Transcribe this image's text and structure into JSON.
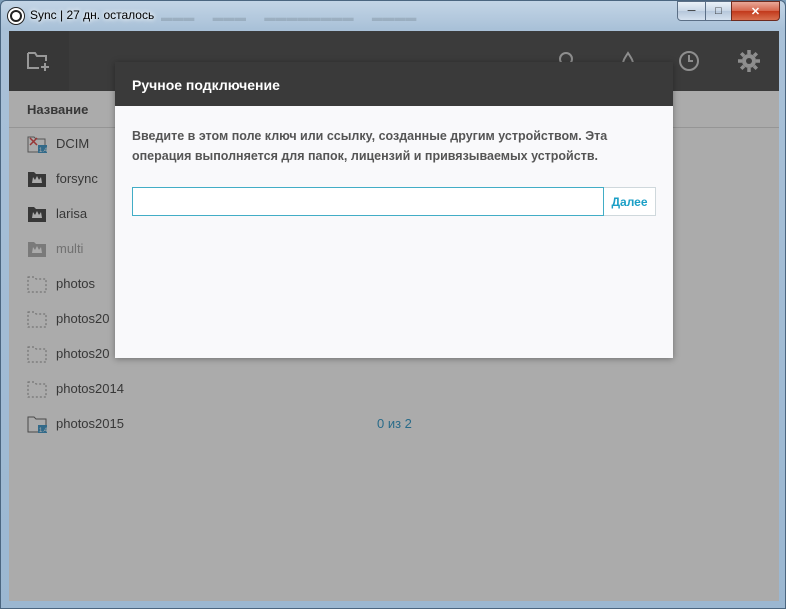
{
  "window": {
    "title": "Sync | 27 дн. осталось",
    "controls": {
      "minimize": "─",
      "maximize": "□",
      "close": "✕"
    }
  },
  "toolbar": {
    "icons": [
      "add-folder-icon",
      "search-icon",
      "drop-icon",
      "history-icon",
      "settings-icon"
    ]
  },
  "table": {
    "name_header": "Название"
  },
  "folders": [
    {
      "name": "DCIM",
      "status": ""
    },
    {
      "name": "forsync",
      "status": ""
    },
    {
      "name": "larisa",
      "status": ""
    },
    {
      "name": "multi",
      "status": ""
    },
    {
      "name": "photos",
      "status": ""
    },
    {
      "name": "photos20",
      "status": ""
    },
    {
      "name": "photos20",
      "status": ""
    },
    {
      "name": "photos2014",
      "status": ""
    },
    {
      "name": "photos2015",
      "status": "0 из 2"
    }
  ],
  "dialog": {
    "title": "Ручное подключение",
    "description": "Введите в этом поле ключ или ссылку, созданные другим устройством. Эта операция выполняется для папок, лицензий и привязываемых устройств.",
    "input_value": "",
    "next_label": "Далее"
  },
  "colors": {
    "accent": "#1b9fc6",
    "toolbar": "#3b3b3b",
    "input_border": "#42adc6"
  }
}
